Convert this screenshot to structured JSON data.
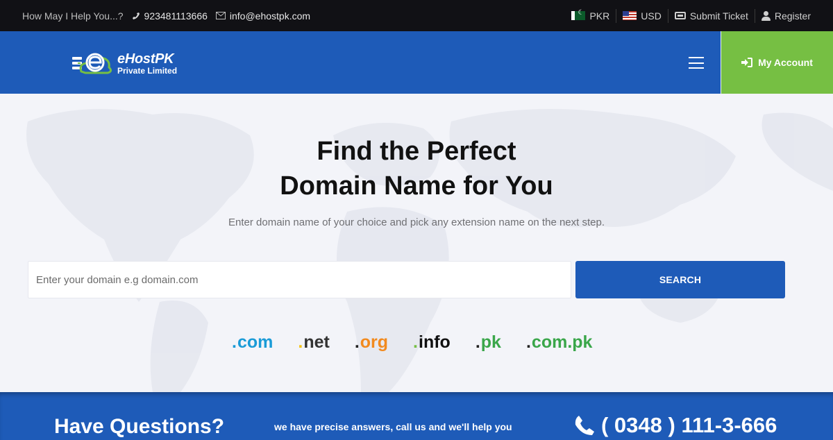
{
  "topbar": {
    "help_text": "How May I Help You...?",
    "phone": "923481113666",
    "email": "info@ehostpk.com",
    "currencies": [
      {
        "label": "PKR",
        "icon": "pakistan-flag-icon"
      },
      {
        "label": "USD",
        "icon": "us-flag-icon"
      }
    ],
    "submit_ticket": "Submit Ticket",
    "register": "Register"
  },
  "header": {
    "brand_name": "eHostPK",
    "brand_sub": "Private Limited",
    "menu_icon": "hamburger-icon",
    "account_label": "My Account",
    "account_icon": "sign-in-icon"
  },
  "hero": {
    "title_line1": "Find the Perfect",
    "title_line2": "Domain Name for You",
    "subtitle": "Enter domain name of your choice and pick any extension name on the next step.",
    "search_placeholder": "Enter your domain e.g domain.com",
    "search_button": "SEARCH",
    "tlds": [
      {
        "name": "com",
        "dot_color": "#1a9bd7",
        "text_color": "#1a9bd7"
      },
      {
        "name": "net",
        "dot_color": "#f5c518",
        "text_color": "#333333"
      },
      {
        "name": "org",
        "dot_color": "#222222",
        "text_color": "#f28a1e"
      },
      {
        "name": "info",
        "dot_color": "#76bf43",
        "text_color": "#111111"
      },
      {
        "name": "pk",
        "dot_color": "#222222",
        "text_color": "#3aa64a"
      },
      {
        "name": "com.pk",
        "dot_color": "#222222",
        "text_color": "#3aa64a"
      }
    ]
  },
  "banner": {
    "heading": "Have Questions?",
    "description": "we have precise answers, call us and we'll help you",
    "phone": "( 0348 ) 111-3-666"
  },
  "colors": {
    "primary_blue": "#1e5bb8",
    "accent_green": "#76bf43",
    "topbar_bg": "#111115"
  }
}
